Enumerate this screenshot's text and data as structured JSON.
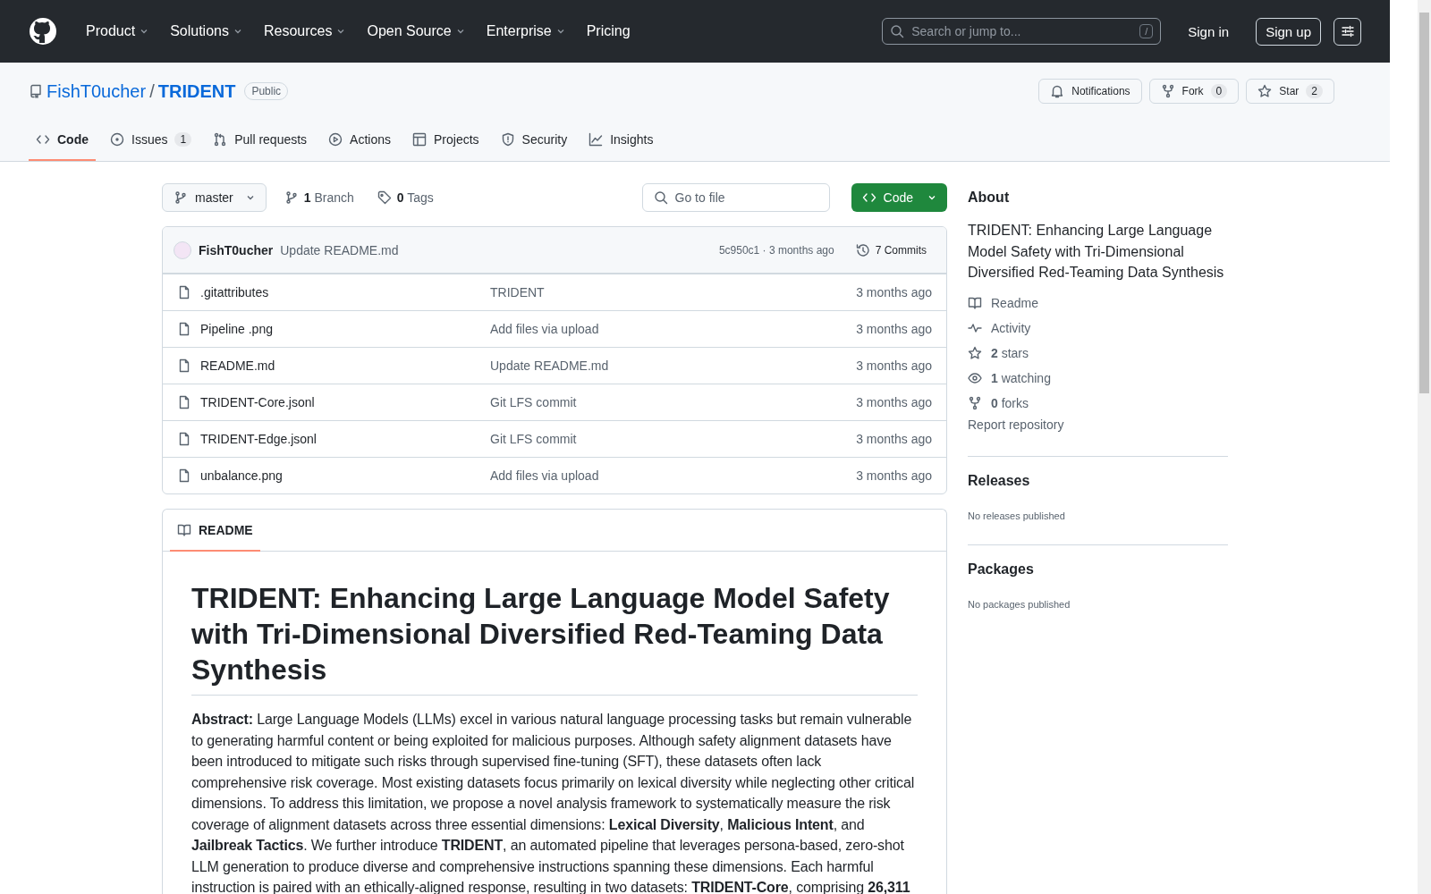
{
  "header": {
    "nav": [
      {
        "label": "Product",
        "dropdown": true
      },
      {
        "label": "Solutions",
        "dropdown": true
      },
      {
        "label": "Resources",
        "dropdown": true
      },
      {
        "label": "Open Source",
        "dropdown": true
      },
      {
        "label": "Enterprise",
        "dropdown": true
      },
      {
        "label": "Pricing",
        "dropdown": false
      }
    ],
    "search": {
      "placeholder": "Search or jump to...",
      "shortcut": "/"
    },
    "sign_in": "Sign in",
    "sign_up": "Sign up"
  },
  "repo": {
    "owner": "FishT0ucher",
    "separator": "/",
    "name": "TRIDENT",
    "visibility": "Public",
    "actions": [
      {
        "label": "Notifications"
      },
      {
        "label": "Fork",
        "count": "0"
      },
      {
        "label": "Star",
        "count": "2"
      }
    ]
  },
  "tabs": [
    {
      "label": "Code",
      "selected": true
    },
    {
      "label": "Issues",
      "count": "1",
      "selected": false
    },
    {
      "label": "Pull requests",
      "selected": false
    },
    {
      "label": "Actions",
      "selected": false
    },
    {
      "label": "Projects",
      "selected": false
    },
    {
      "label": "Security",
      "selected": false
    },
    {
      "label": "Insights",
      "selected": false
    }
  ],
  "toolbar": {
    "branch": "master",
    "branches": "**1** Branch",
    "tags": "**0** Tags",
    "goto_placeholder": "Go to file",
    "code_button": "Code"
  },
  "commit": {
    "author": "FishT0ucher",
    "message": "Update README.md",
    "meta": "5c950c1 · 3 months ago",
    "commits": "7 Commits"
  },
  "files": [
    {
      "name": ".gitattributes",
      "message": "TRIDENT",
      "time": "3 months ago"
    },
    {
      "name": "Pipeline .png",
      "message": "Add files via upload",
      "time": "3 months ago"
    },
    {
      "name": "README.md",
      "message": "Update README.md",
      "time": "3 months ago"
    },
    {
      "name": "TRIDENT-Core.jsonl",
      "message": "Git LFS commit",
      "time": "3 months ago"
    },
    {
      "name": "TRIDENT-Edge.jsonl",
      "message": "Git LFS commit",
      "time": "3 months ago"
    },
    {
      "name": "unbalance.png",
      "message": "Add files via upload",
      "time": "3 months ago"
    }
  ],
  "readme": {
    "tab": "README",
    "title": "TRIDENT: Enhancing Large Language Model Safety with Tri-Dimensional Diversified Red-Teaming Data Synthesis",
    "abstract": "**Abstract:** Large Language Models (LLMs) excel in various natural language processing tasks but remain vulnerable to generating harmful content or being exploited for malicious purposes. Although safety alignment datasets have been introduced to mitigate such risks through supervised fine-tuning (SFT), these datasets often lack comprehensive risk coverage. Most existing datasets focus primarily on lexical diversity while neglecting other critical dimensions. To address this limitation, we propose a novel analysis framework to systematically measure the risk coverage of alignment datasets across three essential dimensions: **Lexical Diversity**, **Malicious Intent**, and **Jailbreak Tactics**. We further introduce **TRIDENT**, an automated pipeline that leverages persona-based, zero-shot LLM generation to produce diverse and comprehensive instructions spanning these dimensions. Each harmful instruction is paired with an ethically-aligned response, resulting in two datasets: **TRIDENT-Core**, comprising **26,311**"
  },
  "about": {
    "heading": "About",
    "description": "TRIDENT: Enhancing Large Language Model Safety with Tri-Dimensional Diversified Red-Teaming Data Synthesis",
    "links": [
      {
        "label": "Readme"
      },
      {
        "label": "Activity"
      },
      {
        "label": "**2** stars"
      },
      {
        "label": "**1** watching"
      },
      {
        "label": "**0** forks"
      }
    ],
    "report": "Report repository"
  },
  "releases": {
    "heading": "Releases",
    "text": "No releases published"
  },
  "packages": {
    "heading": "Packages",
    "text": "No packages published"
  }
}
